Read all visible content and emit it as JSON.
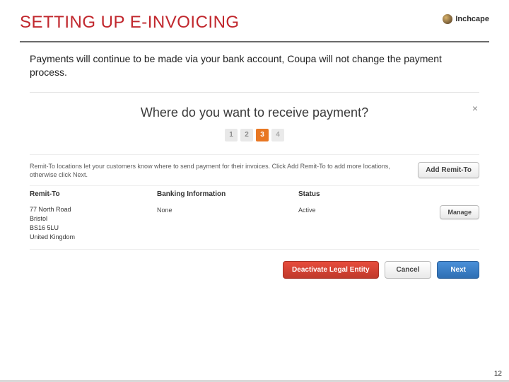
{
  "header": {
    "title": "SETTING UP E-INVOICING",
    "brand": "Inchcape"
  },
  "intro": "Payments will continue to be made via your bank account, Coupa will not change the payment process.",
  "modal": {
    "title": "Where do you want to receive payment?",
    "close": "×",
    "steps": [
      "1",
      "2",
      "3",
      "4"
    ],
    "active_step": 3,
    "helper": "Remit-To locations let your customers know where to send payment for their invoices. Click Add Remit-To to add more locations, otherwise click Next.",
    "add_remit_label": "Add Remit-To",
    "columns": {
      "remit": "Remit-To",
      "bank": "Banking Information",
      "status": "Status"
    },
    "row": {
      "address_lines": [
        "77 North Road",
        "Bristol",
        "BS16 5LU",
        "United Kingdom"
      ],
      "banking": "None",
      "status": "Active",
      "manage": "Manage"
    },
    "actions": {
      "deactivate": "Deactivate Legal Entity",
      "cancel": "Cancel",
      "next": "Next"
    }
  },
  "page_number": "12"
}
